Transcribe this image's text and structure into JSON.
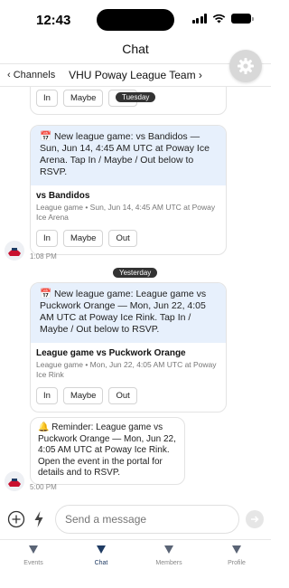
{
  "status_bar": {
    "time": "12:43"
  },
  "header": {
    "title": "Chat",
    "back_label": "‹ Channels",
    "team_name": "VHU Poway League Team ›",
    "settings_icon": "gear-icon"
  },
  "messages": {
    "partial_card": {
      "rsvp": [
        "In",
        "Maybe",
        "Out"
      ]
    },
    "day_pill_1": "Tuesday",
    "card_1": {
      "text": "📅 New league game: vs Bandidos — Sun, Jun 14, 4:45 AM UTC at Poway Ice Arena. Tap In / Maybe / Out below to RSVP.",
      "event_title": "vs Bandidos",
      "event_meta": "League game • Sun, Jun 14, 4:45 AM UTC at Poway Ice Arena",
      "rsvp": [
        "In",
        "Maybe",
        "Out"
      ],
      "time": "1:08 PM"
    },
    "day_pill_2": "Yesterday",
    "card_2": {
      "text": "📅 New league game: League game vs Puckwork Orange — Mon, Jun 22, 4:05 AM UTC at Poway Ice Rink. Tap In / Maybe / Out below to RSVP.",
      "event_title": "League game vs Puckwork Orange",
      "event_meta": "League game • Mon, Jun 22, 4:05 AM UTC at Poway Ice Rink",
      "rsvp": [
        "In",
        "Maybe",
        "Out"
      ]
    },
    "reminder": {
      "text": "🔔 Reminder: League game vs Puckwork Orange — Mon, Jun 22, 4:05 AM UTC at Poway Ice Rink. Open the event in the portal for details and to RSVP.",
      "time": "5:00 PM"
    }
  },
  "composer": {
    "placeholder": "Send a message"
  },
  "tabs": [
    {
      "label": "Events",
      "active": false
    },
    {
      "label": "Chat",
      "active": true
    },
    {
      "label": "Members",
      "active": false
    },
    {
      "label": "Profile",
      "active": false
    }
  ],
  "colors": {
    "accent": "#1f3b63",
    "bubble_blue": "#e7f0fc",
    "pill": "#333333"
  }
}
